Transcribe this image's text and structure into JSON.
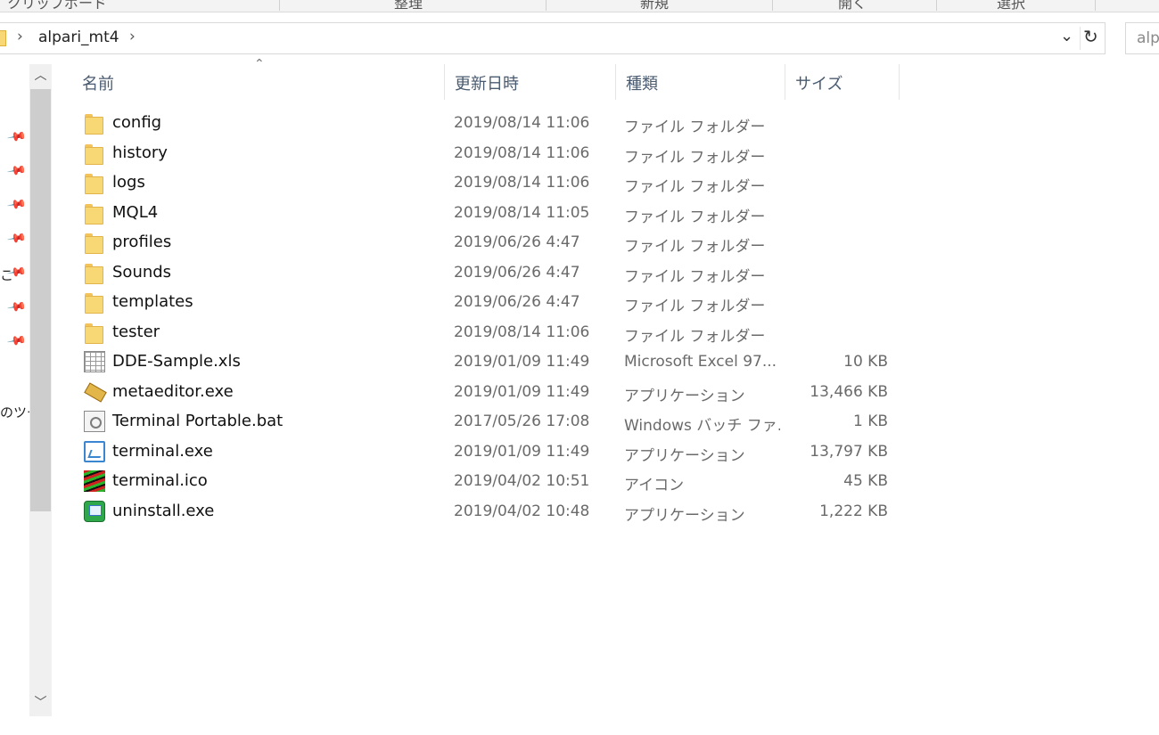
{
  "ribbon": {
    "groups": [
      "クリップボード",
      "整理",
      "新規",
      "開く",
      "選択"
    ]
  },
  "address": {
    "breadcrumb": "alpari_mt4",
    "search_placeholder": "alp"
  },
  "nav_fragments": [
    "こ",
    "のツー"
  ],
  "columns": {
    "name": "名前",
    "date": "更新日時",
    "type": "種類",
    "size": "サイズ"
  },
  "files": [
    {
      "name": "config",
      "date": "2019/08/14 11:06",
      "type": "ファイル フォルダー",
      "size": "",
      "icon": "folder-icon"
    },
    {
      "name": "history",
      "date": "2019/08/14 11:06",
      "type": "ファイル フォルダー",
      "size": "",
      "icon": "folder-icon"
    },
    {
      "name": "logs",
      "date": "2019/08/14 11:06",
      "type": "ファイル フォルダー",
      "size": "",
      "icon": "folder-icon"
    },
    {
      "name": "MQL4",
      "date": "2019/08/14 11:05",
      "type": "ファイル フォルダー",
      "size": "",
      "icon": "folder-icon"
    },
    {
      "name": "profiles",
      "date": "2019/06/26 4:47",
      "type": "ファイル フォルダー",
      "size": "",
      "icon": "folder-icon"
    },
    {
      "name": "Sounds",
      "date": "2019/06/26 4:47",
      "type": "ファイル フォルダー",
      "size": "",
      "icon": "folder-icon"
    },
    {
      "name": "templates",
      "date": "2019/06/26 4:47",
      "type": "ファイル フォルダー",
      "size": "",
      "icon": "folder-icon"
    },
    {
      "name": "tester",
      "date": "2019/08/14 11:06",
      "type": "ファイル フォルダー",
      "size": "",
      "icon": "folder-icon"
    },
    {
      "name": "DDE-Sample.xls",
      "date": "2019/01/09 11:49",
      "type": "Microsoft Excel 97...",
      "size": "10 KB",
      "icon": "excel-file-icon"
    },
    {
      "name": "metaeditor.exe",
      "date": "2019/01/09 11:49",
      "type": "アプリケーション",
      "size": "13,466 KB",
      "icon": "metaeditor-icon"
    },
    {
      "name": "Terminal Portable.bat",
      "date": "2017/05/26 17:08",
      "type": "Windows バッチ ファ...",
      "size": "1 KB",
      "icon": "batch-file-icon"
    },
    {
      "name": "terminal.exe",
      "date": "2019/01/09 11:49",
      "type": "アプリケーション",
      "size": "13,797 KB",
      "icon": "terminal-app-icon"
    },
    {
      "name": "terminal.ico",
      "date": "2019/04/02 10:51",
      "type": "アイコン",
      "size": "45 KB",
      "icon": "icon-file-icon"
    },
    {
      "name": "uninstall.exe",
      "date": "2019/04/02 10:48",
      "type": "アプリケーション",
      "size": "1,222 KB",
      "icon": "uninstaller-icon"
    }
  ]
}
